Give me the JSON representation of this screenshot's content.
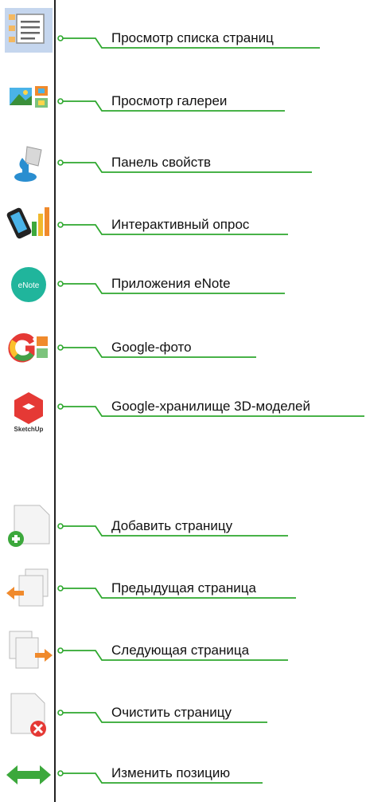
{
  "toolbar": {
    "items": [
      {
        "label": "Просмотр списка страниц",
        "icon": "page-list-icon",
        "active": true
      },
      {
        "label": "Просмотр галереи",
        "icon": "gallery-icon"
      },
      {
        "label": "Панель свойств",
        "icon": "paint-bucket-icon"
      },
      {
        "label": "Интерактивный опрос",
        "icon": "poll-icon"
      },
      {
        "label": "Приложения eNote",
        "icon": "enote-icon",
        "icon_text": "eNote"
      },
      {
        "label": "Google-фото",
        "icon": "google-photo-icon"
      },
      {
        "label": "Google-хранилище 3D-моделей",
        "icon": "sketchup-icon",
        "icon_text": "SketchUp"
      },
      {
        "label": "Добавить страницу",
        "icon": "add-page-icon"
      },
      {
        "label": "Предыдущая страница",
        "icon": "previous-page-icon"
      },
      {
        "label": "Следующая страница",
        "icon": "next-page-icon"
      },
      {
        "label": "Очистить страницу",
        "icon": "clear-page-icon"
      },
      {
        "label": "Изменить позицию",
        "icon": "swap-position-icon"
      }
    ]
  },
  "colors": {
    "callout_line": "#2ea82e",
    "active_bg": "#c5d6ee",
    "toolbar_border": "#222222"
  }
}
